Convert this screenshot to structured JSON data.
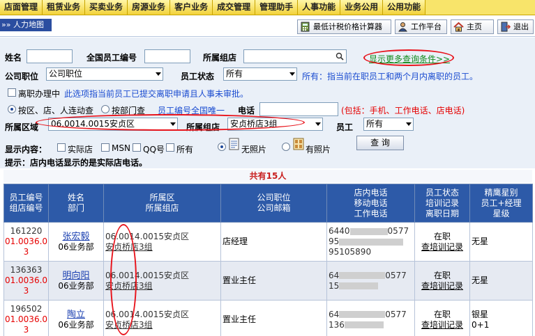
{
  "nav": {
    "items": [
      "店面管理",
      "租赁业务",
      "买卖业务",
      "房源业务",
      "客户业务",
      "成交管理",
      "管理助手",
      "人事功能",
      "业务公用",
      "公用功能"
    ]
  },
  "bar2": {
    "breadcrumb": "»» 人力地图",
    "buttons": {
      "tax": "最低计税价格计算器",
      "workbench": "工作平台",
      "home": "主页",
      "exit": "退出"
    }
  },
  "form": {
    "name_label": "姓名",
    "national_id_label": "全国员工编号",
    "store_label": "所属组店",
    "more_link": "显示更多查询条件>>",
    "position_label": "公司职位",
    "position_value": "公司职位",
    "status_label": "员工状态",
    "status_value": "所有",
    "status_note": "所有：指当前在职员工和两个月内离职的员工。",
    "resign_checkbox": "离职办理中",
    "resign_note": "此选项指当前员工已提交离职申请且人事未审批。",
    "radio_area": "按区、店、人连动查",
    "radio_dept": "按部门查",
    "unique_note": "员工编号全国唯一",
    "phone_label": "电话",
    "phone_note": "(包括：手机、工作电话、店电话)",
    "region_label": "所属区域",
    "region_value": "06.0014.0015安贞区",
    "store2_label": "所属组店",
    "store2_value": "安贞桥店3组",
    "employee_label": "员工",
    "employee_value": "所有",
    "display_label": "显示内容：",
    "opt_actual": "实际店",
    "opt_msn": "MSN",
    "opt_qq": "QQ号",
    "opt_all": "所有",
    "opt_nophoto": "无照片",
    "opt_photo": "有照片",
    "query_btn": "查 询",
    "tip": "提示：店内电话显示的是实际店电话。"
  },
  "table": {
    "total": "共有15人",
    "headers": [
      [
        "员工编号",
        "组店编号"
      ],
      [
        "姓名",
        "部门"
      ],
      [
        "所属区",
        "所属组店"
      ],
      [
        "公司职位",
        "公司邮箱"
      ],
      [
        "店内电话",
        "移动电话",
        "工作电话"
      ],
      [
        "员工状态",
        "培训记录",
        "离职日期"
      ],
      [
        "精鹰星别",
        "员工+经理",
        "星级"
      ]
    ],
    "rows": [
      {
        "id": "161220",
        "code": [
          "01.0036.0",
          "3"
        ],
        "name": "张宏毅",
        "dept": "06业务部",
        "area": "06.0014.0015安贞区",
        "store": "安贞桥店3组",
        "position": "店经理",
        "phones": [
          "6440",
          "0577",
          "95",
          "95105890"
        ],
        "status": "在职",
        "record": "查培训记录",
        "star": "无星",
        "star2": ""
      },
      {
        "id": "136363",
        "code": [
          "01.0036.0",
          "3"
        ],
        "name": "明向阳",
        "dept": "06业务部",
        "area": "06.0014.0015安贞区",
        "store": "安贞桥店3组",
        "position": "置业主任",
        "phones": [
          "64",
          "0577",
          "15",
          ""
        ],
        "status": "在职",
        "record": "查培训记录",
        "star": "无星",
        "star2": ""
      },
      {
        "id": "196502",
        "code": [
          "01.0036.0",
          "3"
        ],
        "name": "陶立",
        "dept": "06业务部",
        "area": "06.0014.0015安贞区",
        "store": "安贞桥店3组",
        "position": "置业主任",
        "phones": [
          "64",
          "0577",
          "136",
          ""
        ],
        "status": "在职",
        "record": "查培训记录",
        "star": "银星",
        "star2": "0+1"
      }
    ]
  },
  "colors": {
    "nav_bg": "#f8e46a",
    "header_bg": "#2d5aa8",
    "form_bg": "#eaf0f8",
    "annotation": "#e8141c"
  }
}
